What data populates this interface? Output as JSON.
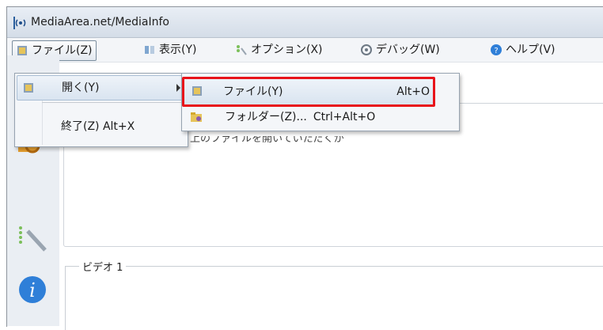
{
  "window": {
    "title": "MediaArea.net/MediaInfo"
  },
  "menubar": {
    "items": [
      {
        "label": "ファイル(Z)",
        "icon": "file-menu-icon"
      },
      {
        "label": "表示(Y)",
        "icon": "view-icon"
      },
      {
        "label": "オプション(X)",
        "icon": "options-icon"
      },
      {
        "label": "デバッグ(W)",
        "icon": "debug-icon"
      },
      {
        "label": "ヘルプ(V)",
        "icon": "help-icon"
      }
    ]
  },
  "file_menu": {
    "open_label": "開く(Y)",
    "exit_label": "終了(Z) Alt+X"
  },
  "open_submenu": {
    "file_label": "ファイル(Y)",
    "file_shortcut": "Alt+O",
    "folder_label": "フォルダー(Z)...",
    "folder_shortcut": "Ctrl+Alt+O"
  },
  "content": {
    "partial_text": "上のファイルを開いていただくか",
    "video_group_label": "ビデオ 1"
  },
  "colors": {
    "highlight_border": "#e8141a",
    "accent": "#2f7fd8"
  }
}
